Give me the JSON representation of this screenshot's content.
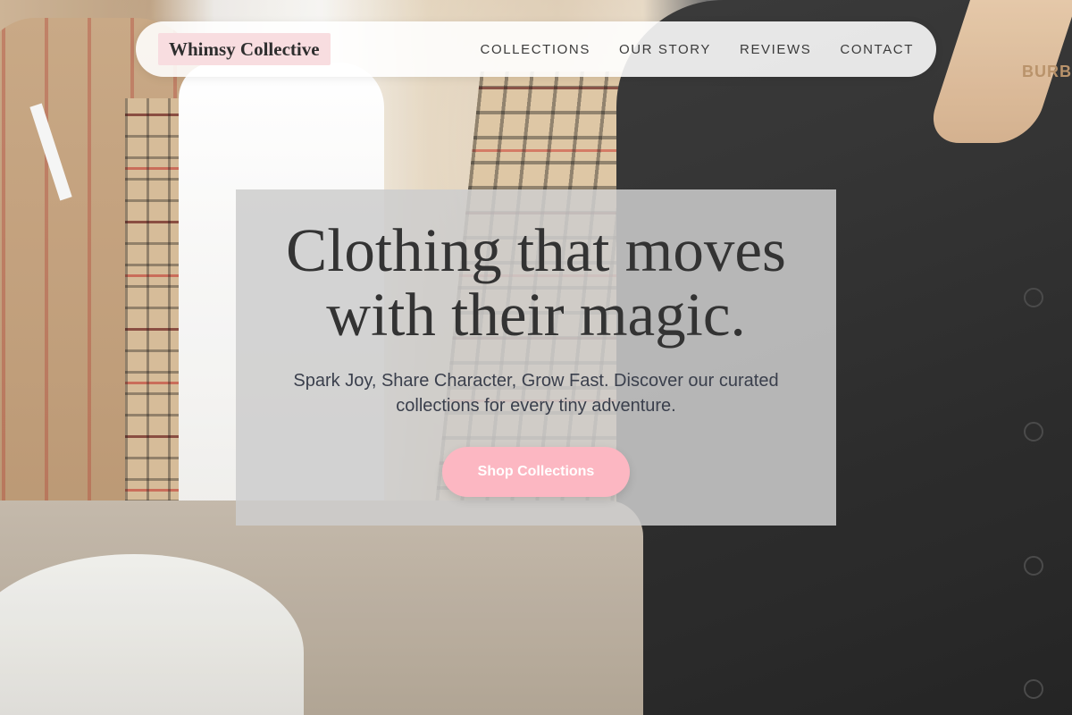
{
  "brand": {
    "name": "Whimsy Collective"
  },
  "nav": {
    "links": [
      "COLLECTIONS",
      "OUR STORY",
      "REVIEWS",
      "CONTACT"
    ]
  },
  "hero": {
    "title_line1": "Clothing that moves",
    "title_line2": "with their magic.",
    "subtitle": "Spark Joy, Share Character, Grow Fast. Discover our curated collections for every tiny adventure.",
    "cta_label": "Shop Collections"
  },
  "background": {
    "hanger_text": "BURB"
  },
  "colors": {
    "brand_bg": "#f8dde0",
    "cta_bg": "#fcb7c2",
    "text_dark": "#333333"
  }
}
